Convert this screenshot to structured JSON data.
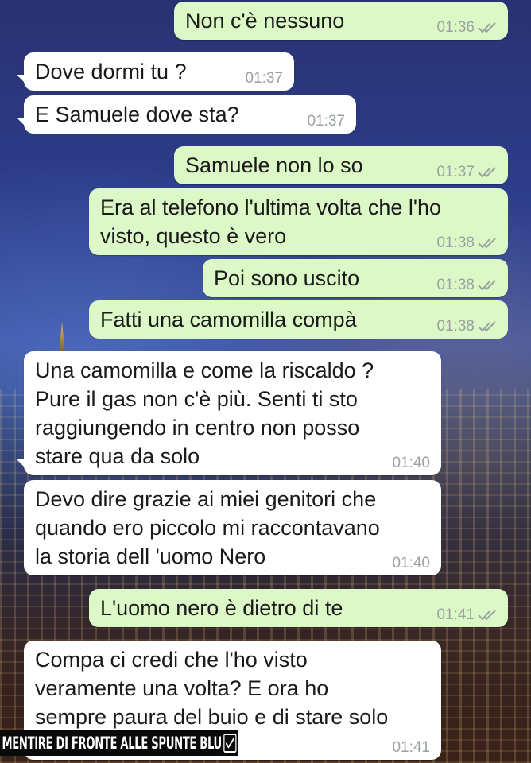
{
  "messages": [
    {
      "dir": "out",
      "text": "Non c'è nessuno",
      "time": "01:36"
    },
    {
      "dir": "in",
      "text": "Dove dormi tu ?",
      "time": "01:37"
    },
    {
      "dir": "in",
      "text": "E Samuele dove sta?",
      "time": "01:37"
    },
    {
      "dir": "out",
      "text": "Samuele non lo so",
      "time": "01:37"
    },
    {
      "dir": "out",
      "text": "Era al telefono l'ultima volta che l'ho\nvisto, questo è vero",
      "time": "01:38"
    },
    {
      "dir": "out",
      "text": "Poi sono uscito",
      "time": "01:38"
    },
    {
      "dir": "out",
      "text": "Fatti una camomilla compà",
      "time": "01:38"
    },
    {
      "dir": "in",
      "text": "Una camomilla e come la riscaldo ?\nPure il gas non c'è più. Senti ti sto\nraggiungendo in centro non posso\nstare qua da solo",
      "time": "01:40"
    },
    {
      "dir": "in",
      "text": "Devo dire grazie ai miei genitori che\nquando ero piccolo mi raccontavano\nla storia dell 'uomo Nero",
      "time": "01:40"
    },
    {
      "dir": "out",
      "text": "L'uomo nero è dietro di te",
      "time": "01:41"
    },
    {
      "dir": "in",
      "text": "Compa ci credi che l'ho visto\nveramente una volta? E ora ho\nsempre paura del buio e di stare solo",
      "time": "01:41"
    }
  ],
  "watermark": {
    "text": "MENTIRE DI FRONTE ALLE SPUNTE BLU"
  },
  "colors": {
    "outgoing": "#dcf8c6",
    "incoming": "#ffffff",
    "meta": "#9aa3a0"
  }
}
